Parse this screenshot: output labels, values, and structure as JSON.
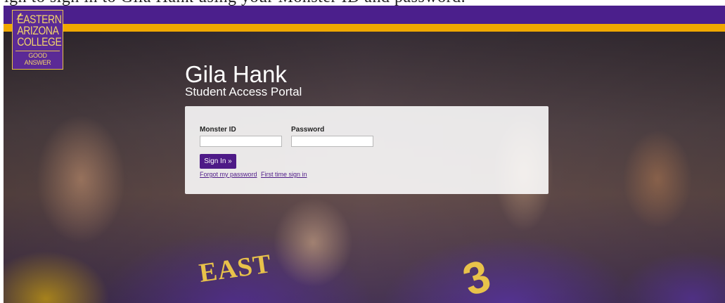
{
  "caption": {
    "text": "igh to sign in to Gila Hank using your Monster ID and password."
  },
  "header": {
    "bar_color": "#4b1f8c",
    "accent_color": "#f0a800"
  },
  "logo": {
    "lines": [
      "EASTERN",
      "ARIZONA",
      "COLLEGE"
    ],
    "tagline": "GOOD ANSWER",
    "icon": "wheat-icon"
  },
  "portal": {
    "title": "Gila Hank",
    "subtitle": "Student Access Portal"
  },
  "form": {
    "username_label": "Monster ID",
    "username_value": "",
    "password_label": "Password",
    "password_value": "",
    "signin_label": "Sign In »",
    "forgot_link": "Forgot my password",
    "first_time_link": "First time sign in"
  },
  "photo": {
    "jersey_text": "EAST",
    "jersey_number": "3"
  },
  "colors": {
    "button": "#4e1a87",
    "gold": "#e8c24a"
  }
}
